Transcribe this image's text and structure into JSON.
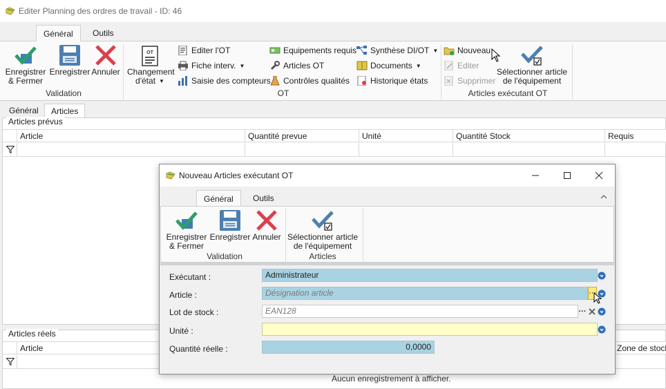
{
  "window": {
    "title": "Editer Planning des ordres de travail - ID: 46"
  },
  "ribbon_tabs": [
    "Général",
    "Outils"
  ],
  "ribbon": {
    "validation": {
      "group_label": "Validation",
      "save_close": [
        "Enregistrer",
        "& Fermer"
      ],
      "save": "Enregistrer",
      "cancel": "Annuler"
    },
    "ot": {
      "group_label": "OT",
      "change_state": [
        "Changement",
        "d'état"
      ],
      "editer_ot": "Editer l'OT",
      "fiche_interv": "Fiche interv.",
      "saisie_compteurs": "Saisie des compteurs",
      "equipements_requis": "Equipements requis",
      "articles_ot": "Articles OT",
      "controles_qualites": "Contrôles qualités",
      "synthese": "Synthèse DI/OT",
      "documents": "Documents",
      "historique": "Historique états"
    },
    "articles_exec": {
      "group_label": "Articles exécutant OT",
      "nouveau": "Nouveau",
      "editer": "Editer",
      "supprimer": "Supprimer",
      "select_article": [
        "Sélectionner article",
        "de l'équipement"
      ]
    }
  },
  "sub_tabs": [
    "Général",
    "Articles"
  ],
  "articles_prevus": {
    "title": "Articles prévus",
    "columns": [
      "Article",
      "Quantité prevue",
      "Unité",
      "Quantité Stock",
      "Requis"
    ]
  },
  "articles_reels": {
    "title": "Articles réels",
    "columns": [
      "Article",
      "Zone de stock"
    ],
    "empty": "Aucun enregistrement à afficher."
  },
  "dialog": {
    "title": "Nouveau Articles exécutant OT",
    "tabs": [
      "Général",
      "Outils"
    ],
    "validation": {
      "group_label": "Validation",
      "save_close": [
        "Enregistrer",
        "& Fermer"
      ],
      "save": "Enregistrer",
      "cancel": "Annuler"
    },
    "articles": {
      "group_label": "Articles",
      "select_article": [
        "Sélectionner article",
        "de l'équipement"
      ]
    },
    "form": {
      "executant_label": "Exécutant :",
      "executant_value": "Administrateur",
      "article_label": "Article :",
      "article_placeholder": "Désignation article",
      "lot_label": "Lot de stock :",
      "lot_placeholder": "EAN128",
      "unite_label": "Unité :",
      "unite_value": "",
      "quantite_label": "Quantité réelle :",
      "quantite_value": "0,0000"
    }
  },
  "colors": {
    "accent_field": "#a9d3e2",
    "required_field": "#ffffc8",
    "check_green": "#2e9e6a",
    "cancel_red": "#d9414c",
    "save_blue": "#4d7fb0"
  }
}
